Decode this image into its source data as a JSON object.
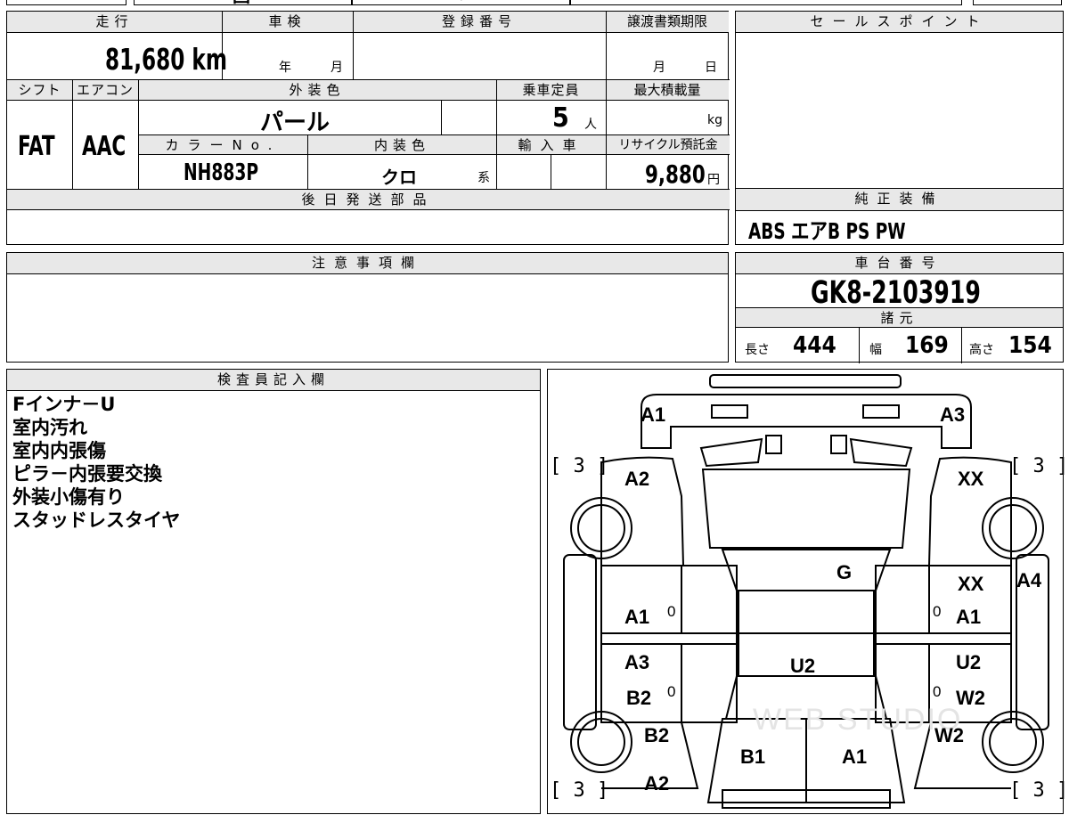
{
  "top_strip": {
    "partial": "国",
    "partial2": "大",
    "partial3": "り"
  },
  "main_info": {
    "mileage_label": "走行",
    "mileage_value": "81,680 km",
    "inspection_label": "車検",
    "inspection_year": "年",
    "inspection_month": "月",
    "registration_label": "登録番号",
    "registration_value": "",
    "transfer_label": "譲渡書類期限",
    "transfer_month": "月",
    "transfer_day": "日",
    "shift_label": "シフト",
    "shift_value": "FAT",
    "ac_label": "エアコン",
    "ac_value": "AAC",
    "exterior_color_label": "外装色",
    "exterior_color_value": "パール",
    "capacity_label": "乗車定員",
    "capacity_value": "5",
    "capacity_unit": "人",
    "max_load_label": "最大積載量",
    "max_load_unit": "kg",
    "color_no_label": "カラーNo.",
    "color_no_value": "NH883P",
    "interior_color_label": "内装色",
    "interior_color_value": "クロ",
    "interior_color_suffix": "系",
    "import_label": "輸入車",
    "recycle_label": "リサイクル預託金",
    "recycle_value": "9,880",
    "recycle_unit": "円",
    "later_parts_label": "後日発送部品",
    "later_parts_value": ""
  },
  "sales_point": {
    "label": "セールスポイント",
    "value": ""
  },
  "equipment": {
    "label": "純正装備",
    "value": "ABS エアB PS PW"
  },
  "notes": {
    "label": "注意事項欄",
    "value": ""
  },
  "chassis": {
    "label": "車台番号",
    "value": "GK8-2103919"
  },
  "dimensions": {
    "label": "諸元",
    "length_label": "長さ",
    "length_value": "444",
    "width_label": "幅",
    "width_value": "169",
    "height_label": "高さ",
    "height_value": "154"
  },
  "inspector": {
    "label": "検査員記入欄",
    "lines": [
      "Fインナ－U",
      "室内汚れ",
      "室内内張傷",
      "ピラ－内張要交換",
      "外装小傷有り",
      "スタッドレスタイヤ"
    ]
  },
  "diagram": {
    "codes": {
      "front_left": "A1",
      "front_right": "A3",
      "fender_fl": "A2",
      "fender_fr": "XX",
      "hood": "G",
      "door_fl": "A1",
      "door_fr_top": "XX",
      "door_fr": "A1",
      "door_fr_side": "A4",
      "door_rl_top": "A3",
      "door_rl": "B2",
      "door_rr_top": "U2",
      "door_rr": "W2",
      "roof": "U2",
      "qtr_rl": "B2",
      "qtr_rr": "W2",
      "rear_left": "B1",
      "rear_right": "A1",
      "rear_fender_l": "A2"
    },
    "tires": {
      "fl": "3",
      "fr": "3",
      "rl": "3",
      "rr": "3"
    },
    "zeros": [
      "0",
      "0",
      "0",
      "0"
    ],
    "watermark": "WEB STUDIO"
  }
}
